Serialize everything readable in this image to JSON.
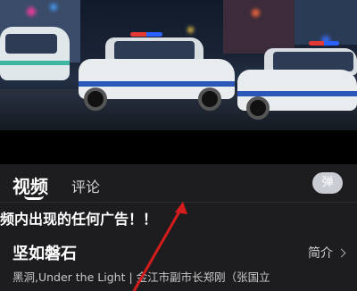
{
  "tabs": {
    "video": "视频",
    "comments": "评论"
  },
  "danmaku_button": "弹",
  "notice": "频内出现的任何广告！！",
  "video_title": "坚如磐石",
  "intro_link": "简介",
  "meta_line": "黑洞,Under the Light | 金江市副市长郑刚（张国立",
  "accent": "#2a57b8"
}
